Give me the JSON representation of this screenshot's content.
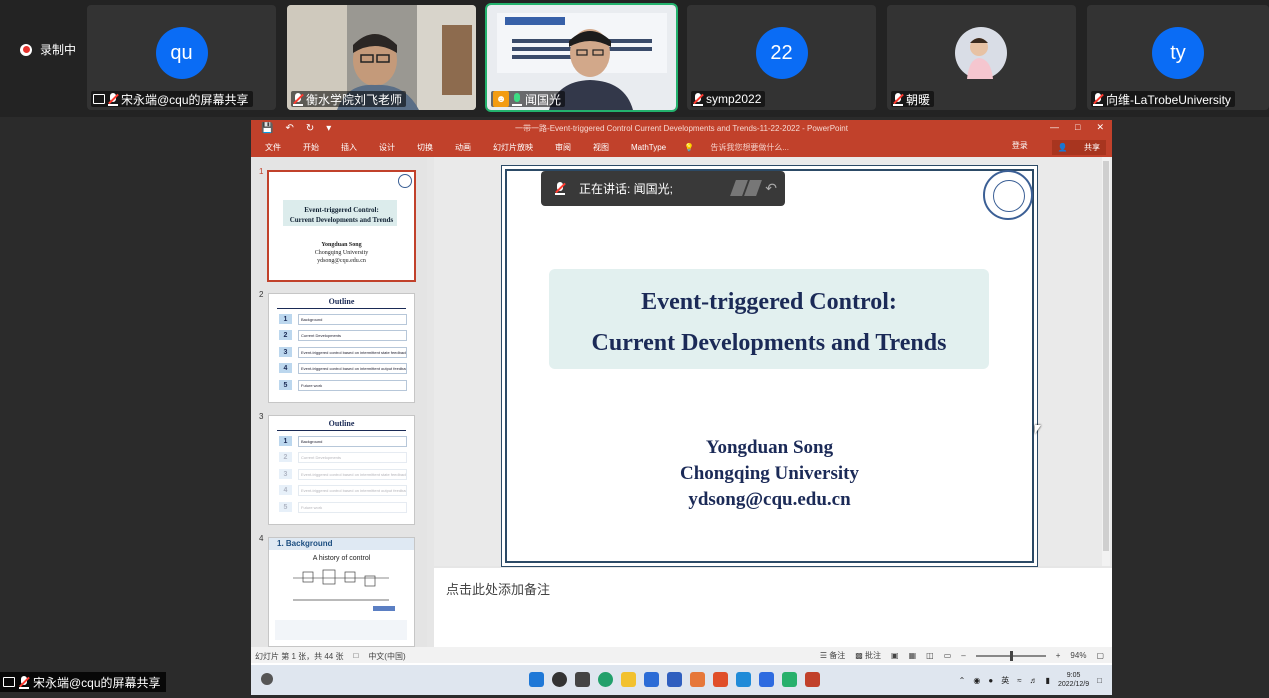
{
  "meeting": {
    "recording_label": "录制中",
    "tiles": [
      {
        "name": "宋永端@cqu的屏幕共享",
        "avatar": "qu",
        "type": "avatar",
        "sharing": true,
        "muted": true
      },
      {
        "name": "衡水学院刘飞老师",
        "type": "video",
        "muted": true
      },
      {
        "name": "闻国光",
        "type": "video",
        "speaking": true,
        "active": true
      },
      {
        "name": "symp2022",
        "avatar": "22",
        "type": "avatar",
        "muted": true
      },
      {
        "name": "朝暖",
        "type": "video",
        "muted": true
      },
      {
        "name": "向维-LaTrobeUniversity",
        "avatar": "ty",
        "type": "avatar",
        "muted": true
      }
    ],
    "speaking_banner": "正在讲话: 闻国光;",
    "sharer_label": "宋永端@cqu的屏幕共享"
  },
  "powerpoint": {
    "window_title": "一带一路-Event-triggered Control Current Developments and Trends-11-22-2022 - PowerPoint",
    "ribbon_tabs": [
      "文件",
      "开始",
      "插入",
      "设计",
      "切换",
      "动画",
      "幻灯片放映",
      "审阅",
      "视图",
      "MathType"
    ],
    "tell_me": "告诉我您想要做什么...",
    "login": "登录",
    "share": "共享",
    "notes_placeholder": "点击此处添加备注",
    "status": {
      "slide_info": "幻灯片 第 1 张，共 44 张",
      "language": "中文(中国)",
      "notes_btn": "备注",
      "comments_btn": "批注",
      "zoom": "94%"
    }
  },
  "slide": {
    "title_line1": "Event-triggered Control:",
    "title_line2": "Current Developments and Trends",
    "author": "Yongduan Song",
    "affiliation": "Chongqing University",
    "email": "ydsong@cqu.edu.cn"
  },
  "thumbnails": {
    "numbers": [
      "1",
      "2",
      "3",
      "4"
    ],
    "t1": {
      "title1": "Event-triggered Control:",
      "title2": "Current Developments and Trends",
      "author": "Yongduan Song",
      "affil": "Chongqing University",
      "email": "ydsong@cqu.edu.cn"
    },
    "outline_head": "Outline",
    "outline_items": [
      "Background",
      "Current Developments",
      "Event-triggered control based on intermittent state feedback",
      "Event-triggered control based on intermittent output feedback",
      "Future work"
    ],
    "t4": {
      "head": "1. Background",
      "sub": "A history of control"
    }
  },
  "taskbar": {
    "time": "9:05",
    "date": "2022/12/9",
    "ime": "英"
  },
  "colors": {
    "ppt_red": "#c1412b",
    "slide_navy": "#1b2a57",
    "title_box": "#e2f0ef",
    "zoom_blue": "#0a6cf5",
    "active_green": "#23b26d"
  }
}
